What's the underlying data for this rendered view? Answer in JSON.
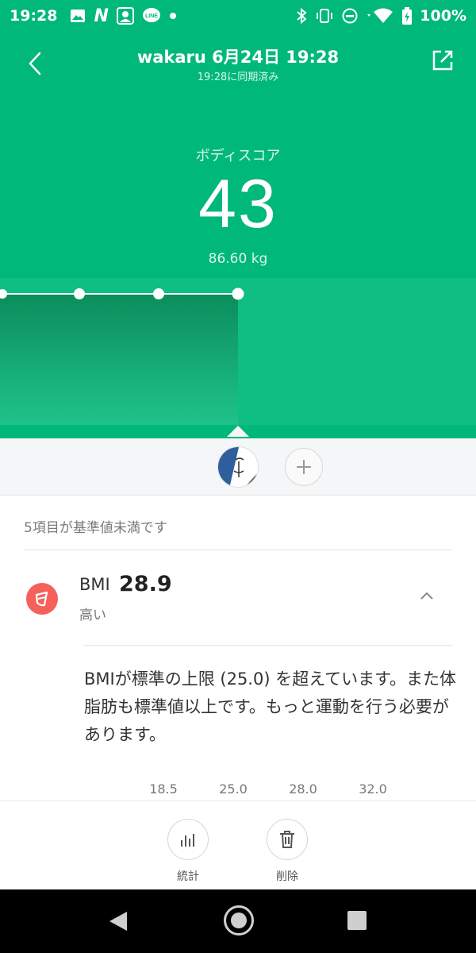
{
  "status_bar": {
    "time": "19:28",
    "battery": "100%",
    "left_icons": [
      "image-icon",
      "n-app-icon",
      "avatar-notif-icon",
      "line-icon",
      "dot-icon"
    ],
    "right_icons": [
      "bluetooth-icon",
      "vibrate-icon",
      "dnd-icon",
      "wifi-icon",
      "battery-icon"
    ]
  },
  "header": {
    "title": "wakaru 6月24日 19:28",
    "subtitle": "19:28に同期済み",
    "score_label": "ボディスコア",
    "score": "43",
    "weight": "86.60 kg",
    "color": "#00b87a"
  },
  "summary": "5項目が基準値未満です",
  "metric": {
    "name": "BMI",
    "value": "28.9",
    "status": "高い",
    "icon_color": "#f5605a",
    "description": "BMIが標準の上限 (25.0) を超えています。また体脂肪も標準値以上です。もっと運動を行う必要があります。",
    "scale": [
      "18.5",
      "25.0",
      "28.0",
      "32.0"
    ]
  },
  "actions": {
    "stats": "統計",
    "delete": "削除"
  }
}
